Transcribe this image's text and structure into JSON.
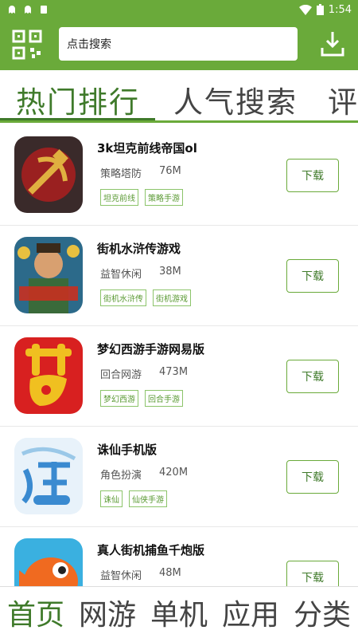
{
  "status_bar": {
    "time": "1:54"
  },
  "header": {
    "search_placeholder": "点击搜索"
  },
  "tabs": [
    "热门排行",
    "人气搜索",
    "评"
  ],
  "apps": [
    {
      "name": "3k坦克前线帝国ol",
      "category": "策略塔防",
      "size": "76M",
      "tags": [
        "坦克前线",
        "策略手游"
      ],
      "download": "下载",
      "icon": "hammer-sickle-icon"
    },
    {
      "name": "街机水浒传游戏",
      "category": "益智休闲",
      "size": "38M",
      "tags": [
        "街机水浒传",
        "街机游戏"
      ],
      "download": "下载",
      "icon": "water-margin-icon"
    },
    {
      "name": "梦幻西游手游网易版",
      "category": "回合网游",
      "size": "473M",
      "tags": [
        "梦幻西游",
        "回合手游"
      ],
      "download": "下载",
      "icon": "dream-char-icon"
    },
    {
      "name": "诛仙手机版",
      "category": "角色扮演",
      "size": "420M",
      "tags": [
        "诛仙",
        "仙侠手游"
      ],
      "download": "下载",
      "icon": "zhuxian-icon"
    },
    {
      "name": "真人街机捕鱼千炮版",
      "category": "益智休闲",
      "size": "48M",
      "tags": [],
      "download": "下载",
      "icon": "fish-icon"
    }
  ],
  "bottom_nav": [
    "首页",
    "网游",
    "单机",
    "应用",
    "分类"
  ],
  "colors": {
    "brand": "#6aaa3a",
    "accent": "#3f7a2a"
  }
}
